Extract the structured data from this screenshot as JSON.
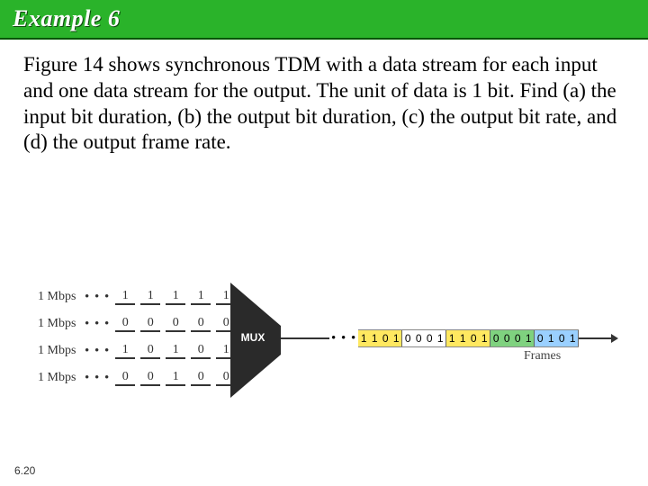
{
  "title": "Example 6",
  "prompt": "Figure 14 shows synchronous TDM with a data stream for each input and one data stream for the output. The unit of data is 1 bit. Find (a) the input bit duration, (b) the output bit duration, (c) the output bit rate, and (d) the output frame rate.",
  "figure": {
    "mux_label": "MUX",
    "rate_label": "1 Mbps",
    "inputs": [
      {
        "bits": [
          "1",
          "1",
          "1",
          "1",
          "1"
        ]
      },
      {
        "bits": [
          "0",
          "0",
          "0",
          "0",
          "0"
        ]
      },
      {
        "bits": [
          "1",
          "0",
          "1",
          "0",
          "1"
        ]
      },
      {
        "bits": [
          "0",
          "0",
          "1",
          "0",
          "0"
        ]
      }
    ],
    "output_frames": [
      [
        "1",
        "1",
        "0",
        "1"
      ],
      [
        "0",
        "0",
        "0",
        "1"
      ],
      [
        "1",
        "1",
        "0",
        "1"
      ],
      [
        "0",
        "0",
        "0",
        "1"
      ],
      [
        "0",
        "1",
        "0",
        "1"
      ]
    ],
    "frame_colors": [
      "c0",
      "c1",
      "c2",
      "c3",
      "c4"
    ],
    "frames_label": "Frames",
    "ellipsis": "• • •"
  },
  "page": "6.20"
}
